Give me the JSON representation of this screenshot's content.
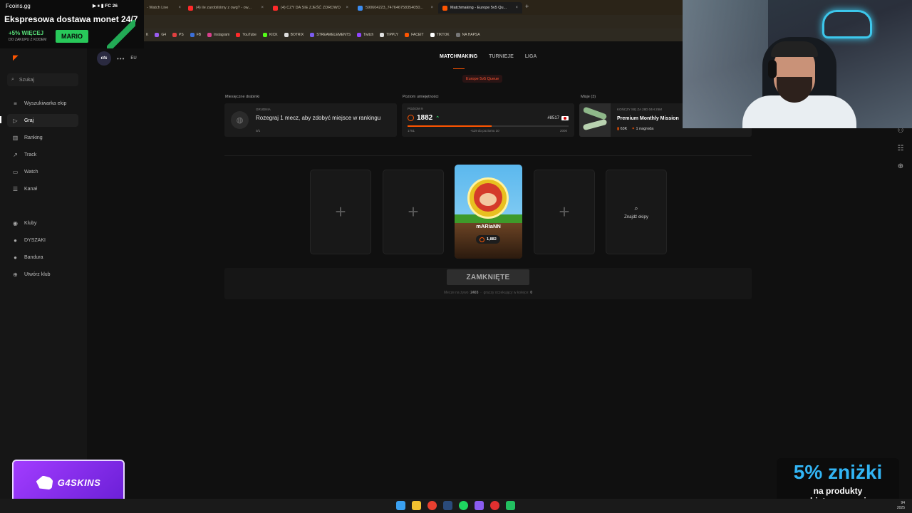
{
  "browser": {
    "tabs": [
      {
        "label": "- Watch Live",
        "color": "#888888"
      },
      {
        "label": "(4) ile zarobiliśmy z owg? - ow...",
        "color": "#ff2a2a"
      },
      {
        "label": "(4) CZY DA SIE ZJEŚĆ ZDROWO",
        "color": "#ff2a2a"
      },
      {
        "label": "590604223_747646758354050...",
        "color": "#3b8cf0"
      },
      {
        "label": "Matchmaking - Europe 5v5 Qu...",
        "color": "#ff5500"
      }
    ],
    "new_tab": "+",
    "close": "×",
    "bookmarks": [
      {
        "label": "K",
        "color": "#7fd04a"
      },
      {
        "label": "G4",
        "color": "#9a5cf0"
      },
      {
        "label": "PS",
        "color": "#e04040"
      },
      {
        "label": "FB",
        "color": "#3b6fd8"
      },
      {
        "label": "Instagram",
        "color": "#d8408c"
      },
      {
        "label": "YouTube",
        "color": "#ff2a2a"
      },
      {
        "label": "KICK",
        "color": "#53fc18"
      },
      {
        "label": "BOTRIX",
        "color": "#dddddd"
      },
      {
        "label": "STREAMELEMENTS",
        "color": "#7b5cf0"
      },
      {
        "label": "Twitch",
        "color": "#9146ff"
      },
      {
        "label": "TIPPLY",
        "color": "#e0e0e0"
      },
      {
        "label": "FACEIT",
        "color": "#ff5500"
      },
      {
        "label": "TIKTOK",
        "color": "#ffffff"
      },
      {
        "label": "NA HAPSA",
        "color": "#777777"
      }
    ]
  },
  "sidebar": {
    "search": "Szukaj",
    "items": [
      {
        "label": "Wyszukiwarka ekip",
        "icon": "≡"
      },
      {
        "label": "Graj",
        "icon": "▷"
      },
      {
        "label": "Ranking",
        "icon": "▥"
      },
      {
        "label": "Track",
        "icon": "↗"
      },
      {
        "label": "Watch",
        "icon": "▭"
      },
      {
        "label": "Kanał",
        "icon": "☰"
      }
    ],
    "clubs": [
      {
        "label": "Kluby",
        "icon": "◉"
      },
      {
        "label": "DYSZAKI",
        "icon": "●"
      },
      {
        "label": "Bandura",
        "icon": "●"
      },
      {
        "label": "Utwórz klub",
        "icon": "⊕"
      }
    ]
  },
  "topbar": {
    "team_tag": "cts",
    "more": "•••",
    "region": "EU"
  },
  "matchmaking": {
    "tabs": [
      "MATCHMAKING",
      "TURNIEJE",
      "LIGA"
    ],
    "queue": "Europe 5v5 Queue"
  },
  "cards": {
    "monthly": {
      "section": "Miesięczne drabinki",
      "caption": "GRUDNIA",
      "text": "Rozegraj 1 mecz, aby zdobyć miejsce w rankingu",
      "progress": "0/1"
    },
    "skill": {
      "section": "Poziom umiejętności",
      "caption": "POZIOM 9",
      "elo": "1882",
      "rank": "#8517",
      "min": "1751",
      "to_next": "+119 do poziomu 10",
      "max": "2000",
      "progress_fraction": 0.52
    },
    "missions": {
      "section": "Misje (3)",
      "caption": "KOŃCZY SIĘ ZA 28D 04H 25M",
      "title": "Premium Monthly Mission",
      "reward_points": "63K",
      "reward_label": "1 nagroda"
    }
  },
  "party": {
    "add": "+",
    "player_name": "mARiaNN",
    "player_elo": "1,882",
    "find": "Znajdź ekipy",
    "status": "ZAMKNIĘTE",
    "live_matches_label": "Mecze na żywo:",
    "live_matches": "2403",
    "queue_label": "graczy oczekujący w kolejce:",
    "queue_count": "0"
  },
  "overlay": {
    "brand": "Fcoins.gg",
    "sys": "▶ ⏸ ▮ FC 26",
    "headline": "Ekspresowa dostawa monet 24/7",
    "bonus": "+5% WIĘCEJ",
    "bonus_sub": "DO ZAKUPU Z KODEM",
    "code": "MARIO",
    "sponsor": "G4SKINS",
    "discount_big": "5% zniżki",
    "discount_l1": "na produkty",
    "discount_l2": "objęte promocją"
  },
  "taskbar": {
    "time": "94",
    "date": "2025"
  }
}
